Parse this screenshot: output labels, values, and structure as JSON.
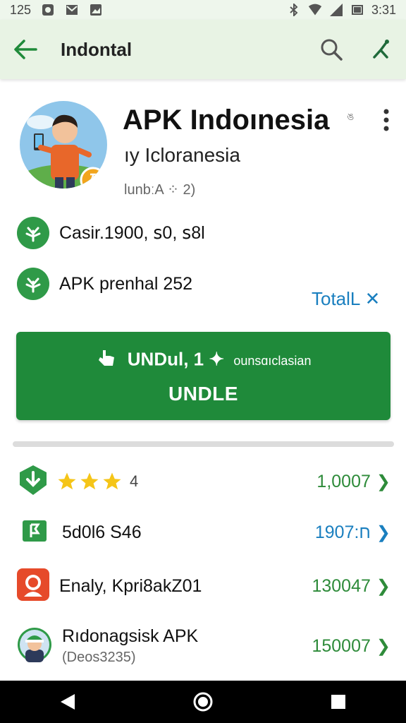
{
  "status_bar": {
    "time_left": "125",
    "time_right": "3:31"
  },
  "app_bar": {
    "title": "Indontal"
  },
  "app": {
    "title": "APK Indoınesia",
    "title_badge": "ঙ",
    "developer": "ıy Icloranesia",
    "version": "lunbːA ⁘ 2)"
  },
  "info_rows": [
    {
      "label": "Casir.1900, ꜱ0, ꜱ8l"
    },
    {
      "label": "APK  prenhal 252"
    }
  ],
  "total_link": "TotalL ✕",
  "download": {
    "line1": "UNDul, 1 ✦",
    "line1_small": "ounsɑıclasian",
    "line2": "UNDLE"
  },
  "list": [
    {
      "text": "4",
      "value": "1,0007",
      "value_color": "#2e8b3a"
    },
    {
      "text": "5d0l6 S46",
      "value": "1ח:907",
      "value_color": "#1a7fbf"
    },
    {
      "text": "Enaly, Kpri8akZ01",
      "value": "130047",
      "value_color": "#2e8b3a"
    },
    {
      "text": "Rıdonagsisk APK",
      "subtext": "(Deos3235)",
      "value": "150007",
      "value_color": "#2e8b3a"
    }
  ],
  "colors": {
    "accent": "#1f8a3a",
    "link": "#1a7fbf",
    "app_bar": "#e8f3e4"
  },
  "rating": {
    "stars": 3,
    "max": 3
  }
}
